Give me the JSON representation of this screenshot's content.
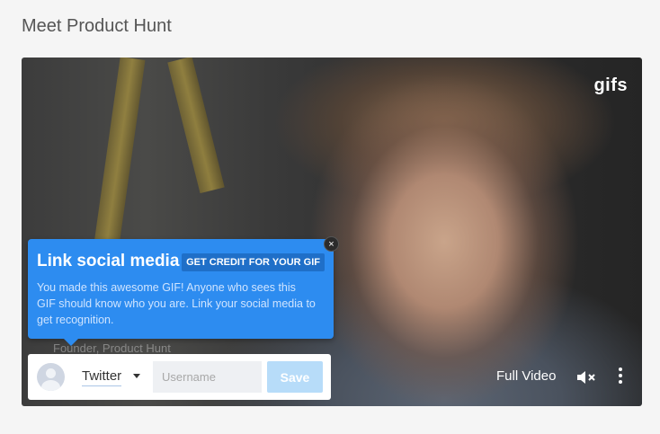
{
  "page_title": "Meet Product Hunt",
  "video": {
    "logo_text": "gifs",
    "caption_ghost": "Founder, Product Hunt",
    "full_video_label": "Full Video"
  },
  "tooltip": {
    "title": "Link social media",
    "badge": "GET CREDIT FOR YOUR GIF",
    "body": "You made this awesome GIF! Anyone who sees this GIF should know who you are. Link your social media to get recognition.",
    "close_symbol": "×"
  },
  "link_bar": {
    "network_selected": "Twitter",
    "username_placeholder": "Username",
    "username_value": "",
    "save_label": "Save"
  },
  "colors": {
    "tooltip_bg": "#2d8cf0",
    "save_bg": "#b7dcf9",
    "page_bg": "#f5f5f5"
  },
  "icons": [
    "user-avatar-icon",
    "chevron-down-icon",
    "mute-icon",
    "more-vertical-icon",
    "close-icon"
  ]
}
